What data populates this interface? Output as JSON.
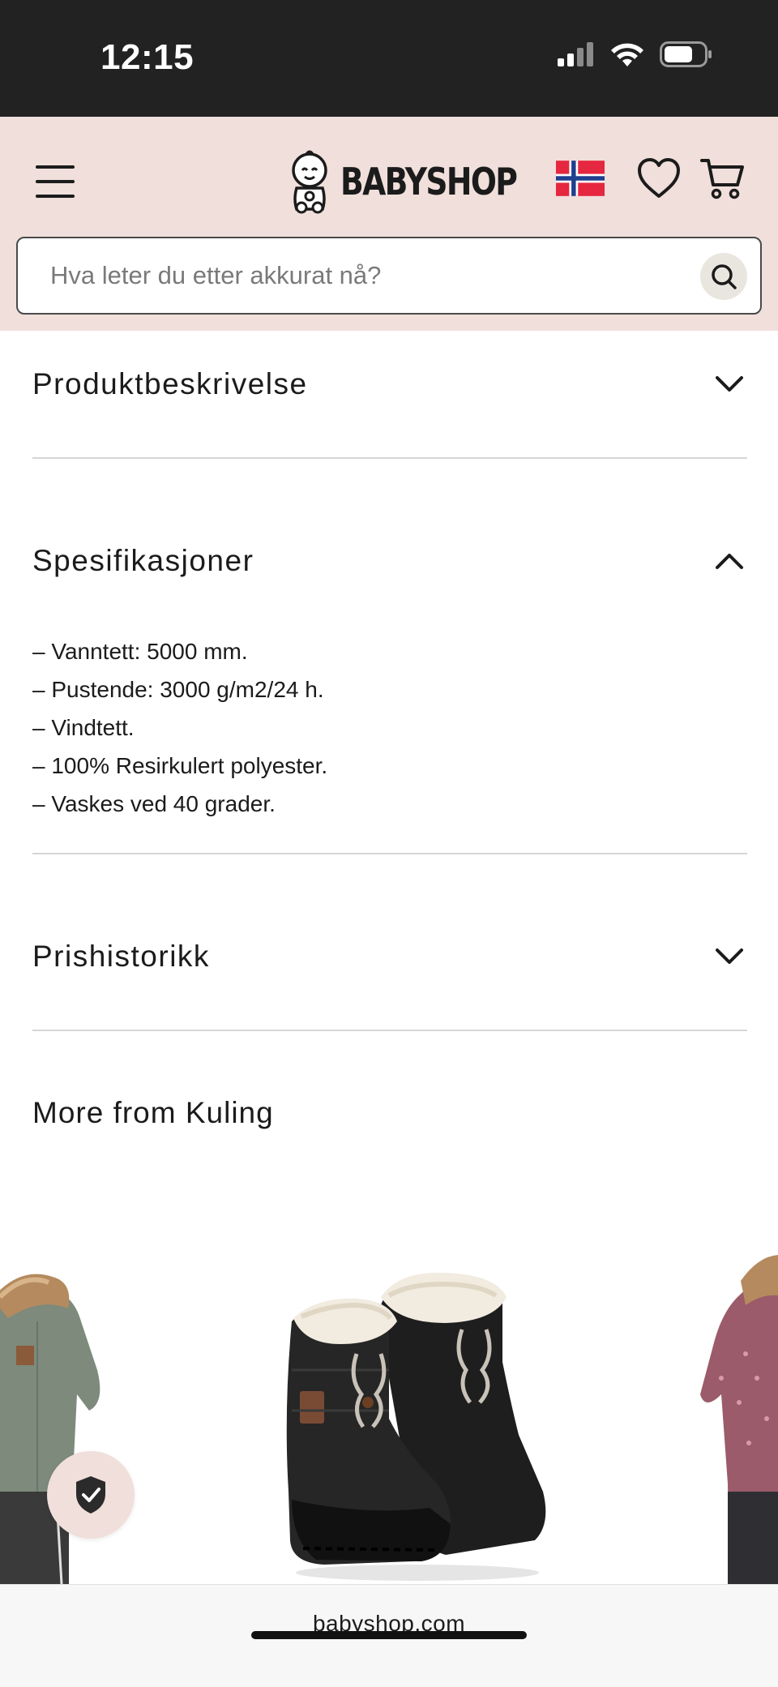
{
  "status_bar": {
    "time": "12:15"
  },
  "header": {
    "logo_text": "BABYSHOP",
    "search_placeholder": "Hva leter du etter akkurat nå?",
    "bg_color": "#f0dfdb",
    "icons": [
      "menu-icon",
      "baby-logo-icon",
      "norway-flag-icon",
      "heart-icon",
      "cart-icon",
      "search-icon"
    ]
  },
  "accordion": [
    {
      "title": "Produktbeskrivelse",
      "expanded": false
    },
    {
      "title": "Spesifikasjoner",
      "expanded": true,
      "items": [
        "– Vanntett: 5000 mm.",
        "– Pustende: 3000 g/m2/24 h.",
        "– Vindtett.",
        "– 100% Resirkulert polyester.",
        "– Vaskes ved 40 grader."
      ]
    },
    {
      "title": "Prishistorikk",
      "expanded": false
    }
  ],
  "more_section": {
    "title": "More from Kuling",
    "products": [
      {
        "name_icon": "green-overall-image"
      },
      {
        "name_icon": "black-winter-boots-image"
      },
      {
        "name_icon": "pink-floral-overall-image"
      }
    ]
  },
  "trust_badge": {
    "icon": "shield-check-icon"
  },
  "browser": {
    "url": "babyshop.com"
  }
}
